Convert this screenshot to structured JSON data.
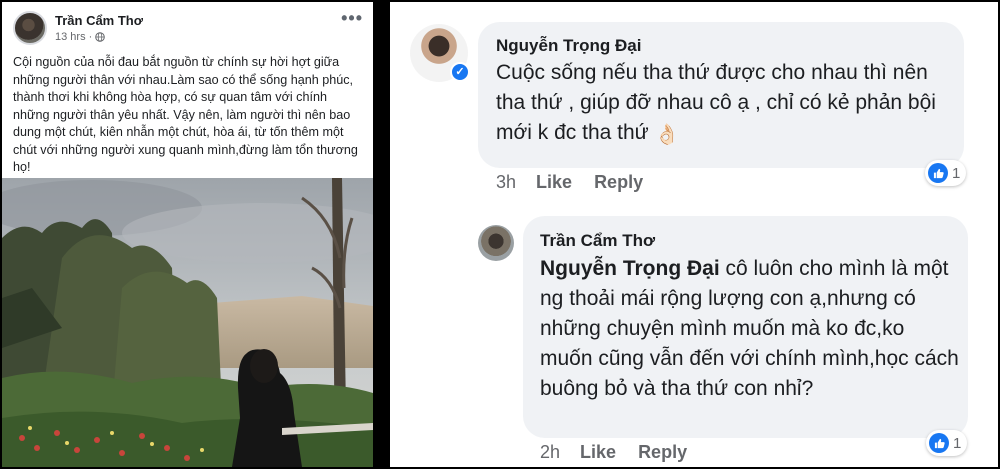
{
  "post": {
    "author": "Trần Cẩm Thơ",
    "time": "13 hrs",
    "separator": "·",
    "text": "Cội nguồn của nỗi đau bắt nguồn từ chính sự hời hợt giữa những người thân với nhau.Làm sao có thể sống hạnh phúc, thành thơi khi không hòa hợp, có sự quan tâm với chính những người thân yêu nhất. Vậy nên, làm người thì nên bao dung một chút, kiên nhẫn một chút, hòa ái, từ tốn thêm một chút với những người xung quanh mình,đừng làm tổn thương họ!",
    "more_icon": "more-horizontal-icon",
    "privacy_icon": "globe-icon"
  },
  "comments": [
    {
      "author": "Nguyễn Trọng Đại",
      "verified": true,
      "text": "Cuộc sống nếu tha thứ được cho nhau thì nên tha thứ , giúp đỡ nhau cô ạ ,  chỉ có kẻ phản bội mới k đc tha thứ",
      "emoji": "👌🏻",
      "time": "3h",
      "like": "Like",
      "reply": "Reply",
      "reactions": "1"
    },
    {
      "author": "Trần Cẩm Thơ",
      "mention": "Nguyễn Trọng Đại",
      "text": " cô luôn cho mình là một ng thoải mái rộng lượng con ạ,nhưng có những chuyện mình muốn mà ko đc,ko muốn cũng vẫn đến với chính mình,học cách buông bỏ và tha thứ con nhỉ?",
      "time": "2h",
      "like": "Like",
      "reply": "Reply",
      "reactions": "1"
    }
  ],
  "colors": {
    "accent": "#1877f2",
    "bubble": "#f0f2f5",
    "muted": "#65676b"
  }
}
